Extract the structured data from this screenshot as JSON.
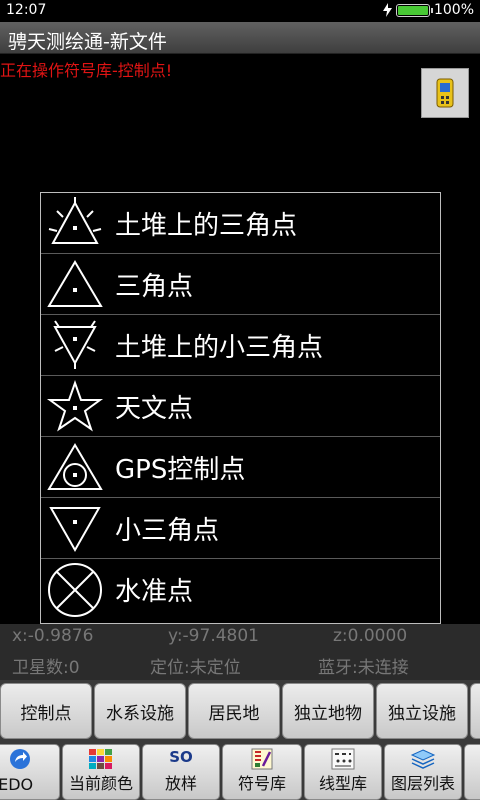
{
  "status": {
    "time": "12:07",
    "battery": "100%",
    "battery_level": 1.0
  },
  "app": {
    "title": "骋天测绘通-新文件"
  },
  "operation_message": "正在操作符号库-控制点!",
  "symbol_list": [
    {
      "label": "土堆上的三角点",
      "icon": "triangle-on-mound-icon"
    },
    {
      "label": "三角点",
      "icon": "triangle-point-icon"
    },
    {
      "label": "土堆上的小三角点",
      "icon": "small-triangle-on-mound-icon"
    },
    {
      "label": "天文点",
      "icon": "star-point-icon"
    },
    {
      "label": "GPS控制点",
      "icon": "gps-control-point-icon"
    },
    {
      "label": "小三角点",
      "icon": "small-triangle-point-icon"
    },
    {
      "label": "水准点",
      "icon": "level-point-icon"
    }
  ],
  "coords": {
    "x": "x:-0.9876",
    "y": "y:-97.4801",
    "z": "z:0.0000",
    "satellites": "卫星数:0",
    "position": "定位:未定位",
    "bluetooth": "蓝牙:未连接"
  },
  "categories": [
    "控制点",
    "水系设施",
    "居民地",
    "独立地物",
    "独立设施"
  ],
  "tools": [
    {
      "label": "REDO",
      "icon": "redo-icon"
    },
    {
      "label": "当前颜色",
      "icon": "color-palette-icon"
    },
    {
      "label": "放样",
      "icon": "stakeout-icon",
      "icon_text": "SO"
    },
    {
      "label": "符号库",
      "icon": "symbol-library-icon"
    },
    {
      "label": "线型库",
      "icon": "line-type-library-icon"
    },
    {
      "label": "图层列表",
      "icon": "layer-list-icon"
    }
  ],
  "colors": {
    "operation_message": "#e01414",
    "battery": "#49c935",
    "coords_text": "#777777"
  }
}
